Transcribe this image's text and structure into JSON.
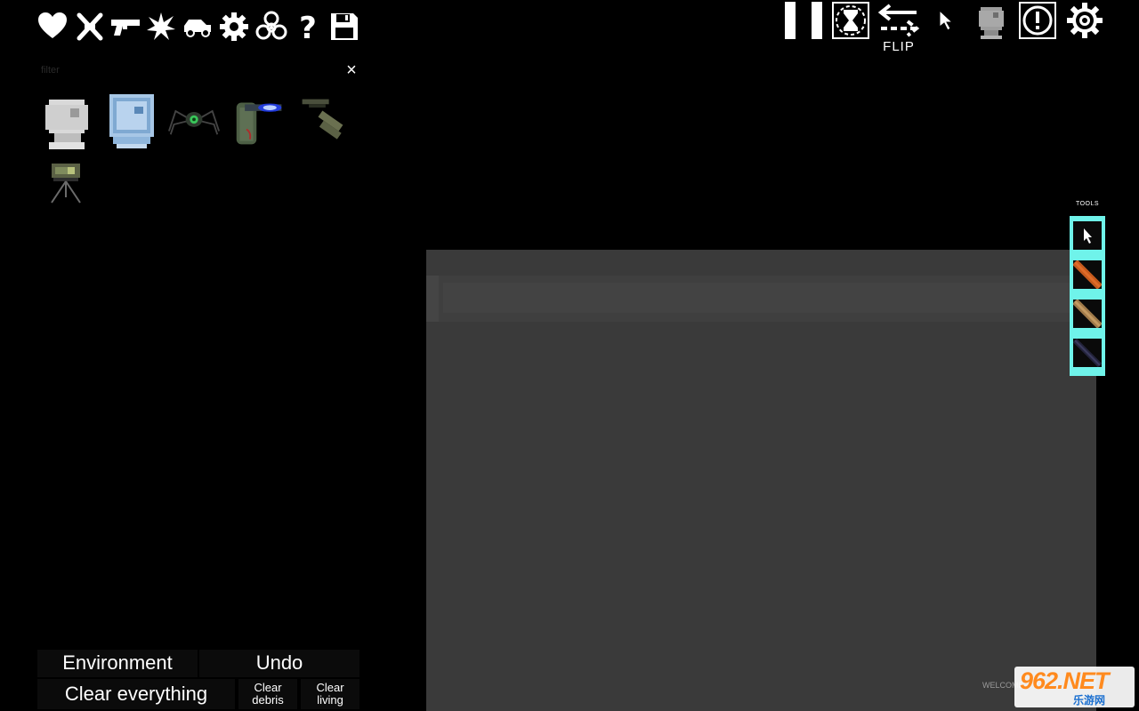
{
  "categories": [
    {
      "name": "heart-icon",
      "label": "Biological"
    },
    {
      "name": "crossed-swords-icon",
      "label": "Melee"
    },
    {
      "name": "pistol-icon",
      "label": "Firearms"
    },
    {
      "name": "explosion-icon",
      "label": "Explosives"
    },
    {
      "name": "car-icon",
      "label": "Vehicles"
    },
    {
      "name": "gear-icon",
      "label": "Machinery"
    },
    {
      "name": "biohazard-icon",
      "label": "Chemistry"
    },
    {
      "name": "question-mark-icon",
      "label": "Misc"
    },
    {
      "name": "save-icon",
      "label": "Saved"
    }
  ],
  "filter": {
    "placeholder": "filter"
  },
  "close_glyph": "×",
  "items": [
    "android-head-white",
    "android-head-blue",
    "spider-drone",
    "cannon-plasma",
    "mounted-turret",
    "tripod-sentry"
  ],
  "toolbar": {
    "pause": "pause-icon",
    "slowmo": "slow-motion-icon",
    "flip": "flip-icon",
    "flip_label": "FLIP",
    "cursor": "cursor-icon",
    "spawn": "spawn-head-icon",
    "notifications": "alert-icon",
    "settings": "settings-gear-icon"
  },
  "tools": {
    "label": "TOOLS",
    "items": [
      "drag-tool",
      "wire-tool-orange",
      "rope-tool-tan",
      "cable-tool-dark"
    ]
  },
  "bottom_buttons": {
    "environment": "Environment",
    "undo": "Undo",
    "clear_everything": "Clear everything",
    "clear_debris": "Clear debris",
    "clear_living": "Clear living"
  },
  "welcome": "WELCOME",
  "watermark": {
    "top": "962.NET",
    "bottom": "乐游网"
  },
  "colors": {
    "tools_accent": "#6ff3ea",
    "world_bg": "#3a3a3a"
  }
}
